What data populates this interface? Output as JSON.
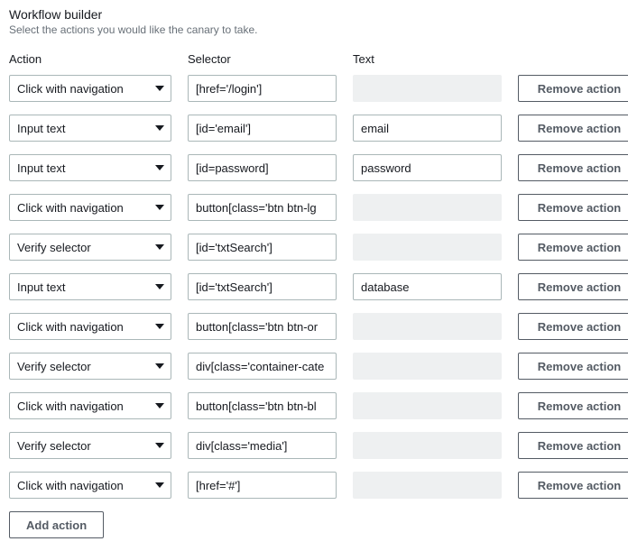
{
  "header": {
    "title": "Workflow builder",
    "subtitle": "Select the actions you would like the canary to take."
  },
  "columns": {
    "action": "Action",
    "selector": "Selector",
    "text": "Text"
  },
  "action_options": [
    "Click with navigation",
    "Input text",
    "Verify selector"
  ],
  "buttons": {
    "remove": "Remove action",
    "add": "Add action"
  },
  "rows": [
    {
      "action": "Click with navigation",
      "selector": "[href='/login']",
      "text": "",
      "text_enabled": false
    },
    {
      "action": "Input text",
      "selector": "[id='email']",
      "text": "email",
      "text_enabled": true
    },
    {
      "action": "Input text",
      "selector": "[id=password]",
      "text": "password",
      "text_enabled": true
    },
    {
      "action": "Click with navigation",
      "selector": "button[class='btn btn-lg",
      "text": "",
      "text_enabled": false
    },
    {
      "action": "Verify selector",
      "selector": "[id='txtSearch']",
      "text": "",
      "text_enabled": false
    },
    {
      "action": "Input text",
      "selector": "[id='txtSearch']",
      "text": "database",
      "text_enabled": true
    },
    {
      "action": "Click with navigation",
      "selector": "button[class='btn btn-or",
      "text": "",
      "text_enabled": false
    },
    {
      "action": "Verify selector",
      "selector": "div[class='container-cate",
      "text": "",
      "text_enabled": false
    },
    {
      "action": "Click with navigation",
      "selector": "button[class='btn btn-bl",
      "text": "",
      "text_enabled": false
    },
    {
      "action": "Verify selector",
      "selector": "div[class='media']",
      "text": "",
      "text_enabled": false
    },
    {
      "action": "Click with navigation",
      "selector": "[href='#']",
      "text": "",
      "text_enabled": false
    }
  ]
}
